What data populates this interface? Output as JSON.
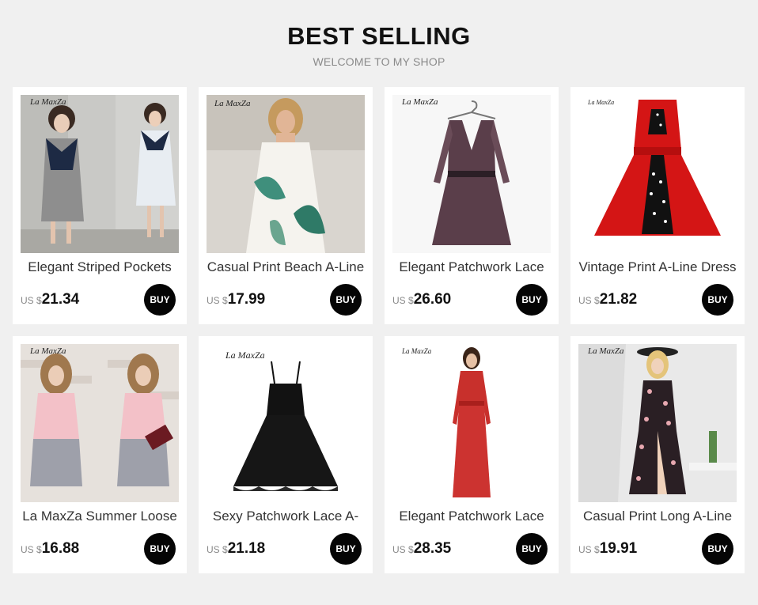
{
  "header": {
    "title": "BEST SELLING",
    "subtitle": "WELCOME TO MY SHOP"
  },
  "brand_logo": "La MaxZa",
  "products": [
    {
      "name": "Elegant Striped Pockets",
      "currency": "US $",
      "price": "21.34",
      "buy_label": "BUY",
      "image": "striped-shirt-dress-photo"
    },
    {
      "name": "Casual Print Beach A-Line",
      "currency": "US $",
      "price": "17.99",
      "buy_label": "BUY",
      "image": "leaf-print-slip-dress-photo"
    },
    {
      "name": "Elegant Patchwork Lace",
      "currency": "US $",
      "price": "26.60",
      "buy_label": "BUY",
      "image": "floral-lace-dress-on-hanger-photo"
    },
    {
      "name": "Vintage Print A-Line Dress",
      "currency": "US $",
      "price": "21.82",
      "buy_label": "BUY",
      "image": "red-polka-dot-dress-photo"
    },
    {
      "name": "La MaxZa Summer Loose",
      "currency": "US $",
      "price": "16.88",
      "buy_label": "BUY",
      "image": "pink-grey-shift-dress-photo"
    },
    {
      "name": "Sexy Patchwork Lace A-",
      "currency": "US $",
      "price": "21.18",
      "buy_label": "BUY",
      "image": "black-lace-slip-dress-photo"
    },
    {
      "name": "Elegant Patchwork Lace",
      "currency": "US $",
      "price": "28.35",
      "buy_label": "BUY",
      "image": "red-maxi-lace-dress-photo"
    },
    {
      "name": "Casual Print Long A-Line",
      "currency": "US $",
      "price": "19.91",
      "buy_label": "BUY",
      "image": "floral-wrap-maxi-dress-photo"
    }
  ]
}
